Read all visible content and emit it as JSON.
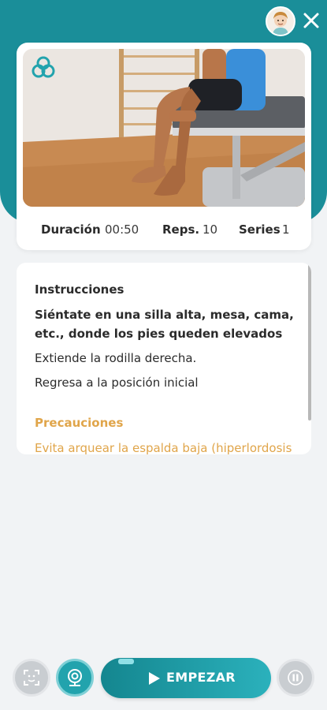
{
  "header": {
    "avatar": "user-avatar",
    "close_icon": "close-icon"
  },
  "video": {
    "logo_icon": "trefoil-logo-icon",
    "description": ""
  },
  "stats": {
    "duration_label": "Duración",
    "duration_value": "00:50",
    "reps_label": "Reps.",
    "reps_value": "10",
    "series_label": "Series",
    "series_value": "1"
  },
  "instructions": {
    "heading": "Instrucciones",
    "lead": "Siéntate en una silla alta, mesa, cama, etc., donde los pies queden elevados",
    "steps": [
      "Extiende la rodilla derecha.",
      "Regresa a la posición inicial"
    ],
    "precautions_heading": "Precauciones",
    "precautions_text": "Evita arquear la espalda baja (hiperlordosis"
  },
  "controls": {
    "scan_icon": "face-scan-icon",
    "camera_icon": "webcam-icon",
    "start_label": "EMPEZAR",
    "start_icon": "play-icon",
    "pause_icon": "pause-icon"
  },
  "colors": {
    "teal": "#1a8e99",
    "accent_orange": "#e0a54a",
    "background": "#f1f3f5"
  }
}
